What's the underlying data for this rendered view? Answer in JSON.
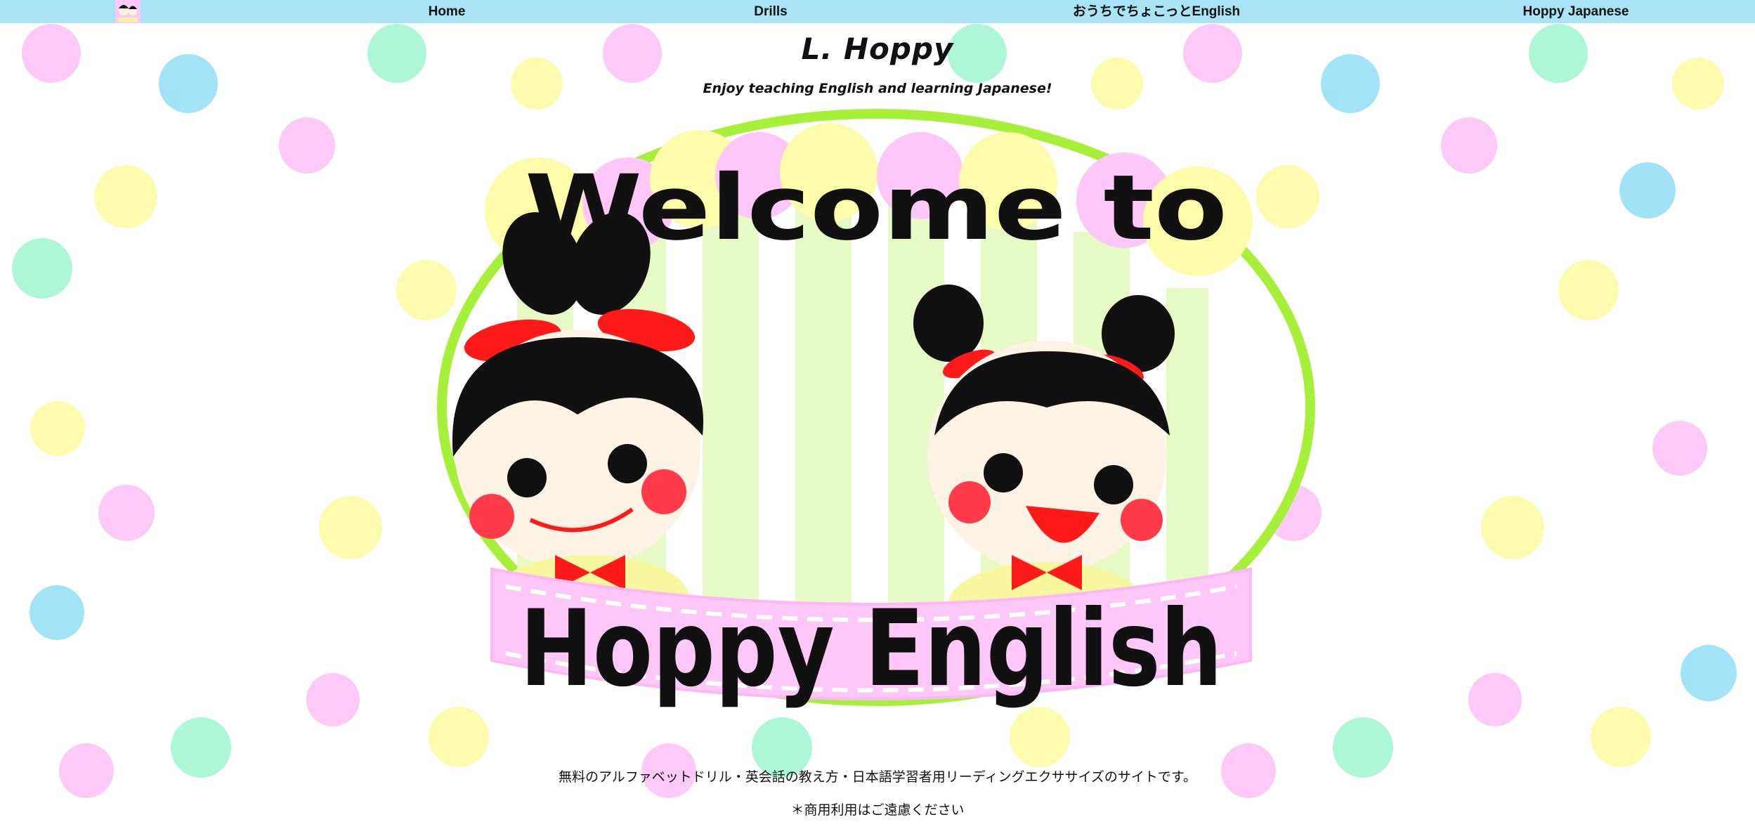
{
  "nav": {
    "items": [
      {
        "label": "Home"
      },
      {
        "label": "Drills"
      },
      {
        "label": "おうちでちょこっとEnglish"
      },
      {
        "label": "Hoppy Japanese"
      }
    ],
    "color": "#a8e4f6"
  },
  "header": {
    "title": "L. Hoppy",
    "tagline": "Enjoy teaching English and learning Japanese!"
  },
  "hero": {
    "welcome_text": "Welcome to",
    "banner_text": "Hoppy English"
  },
  "main": {
    "description": "無料のアルファベットドリル・英会話の教え方・日本語学習者用リーディングエクササイズのサイトです。",
    "note": "＊商用利用はご遠慮ください"
  },
  "colors": {
    "pink": "#fdc7f7",
    "blue": "#9ee1f7",
    "yellow": "#fdfcaa",
    "mint": "#a9f7d6",
    "ring": "#a6f03a"
  }
}
